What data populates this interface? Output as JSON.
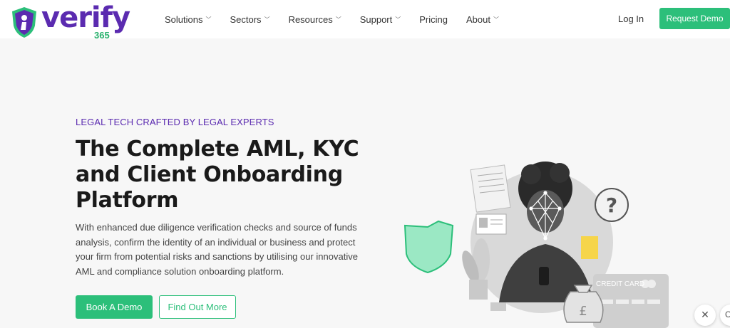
{
  "brand": {
    "name": "verify",
    "number": "365",
    "primary_color": "#5b2bb0",
    "accent_color": "#2cbf7a"
  },
  "nav": {
    "items": [
      {
        "label": "Solutions",
        "has_dropdown": true
      },
      {
        "label": "Sectors",
        "has_dropdown": true
      },
      {
        "label": "Resources",
        "has_dropdown": true
      },
      {
        "label": "Support",
        "has_dropdown": true
      },
      {
        "label": "Pricing",
        "has_dropdown": false
      },
      {
        "label": "About",
        "has_dropdown": true
      }
    ],
    "login_label": "Log In",
    "cta_label": "Request Demo"
  },
  "hero": {
    "eyebrow": "LEGAL TECH CRAFTED BY LEGAL EXPERTS",
    "headline": "The Complete AML, KYC and Client Onboarding Platform",
    "body": "With enhanced due diligence verification checks and source of funds analysis, confirm the identity of an individual or business and protect your firm from potential risks and sanctions by utilising our innovative AML and compliance solution onboarding platform.",
    "primary_button": "Book A Demo",
    "secondary_button": "Find Out More"
  },
  "illustration": {
    "card_label": "CREDIT CARD",
    "icons": [
      "shield-icon",
      "question-icon",
      "id-card-icon",
      "document-icon",
      "sticky-note-icon",
      "money-bag-icon",
      "credit-card-icon",
      "face-scan-icon"
    ]
  },
  "widget": {
    "close_glyph": "✕",
    "edge_glyph": "C"
  }
}
